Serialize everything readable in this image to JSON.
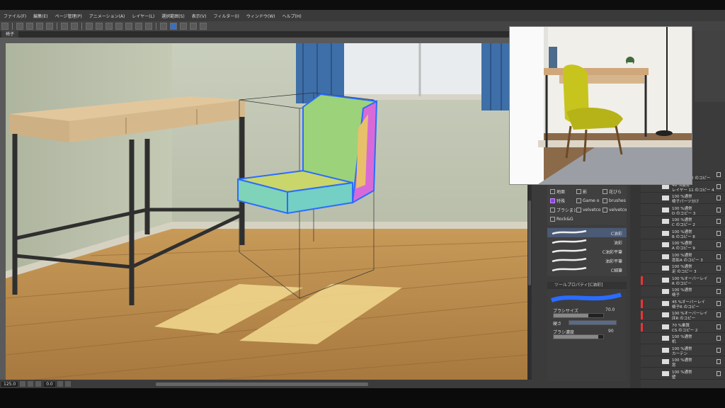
{
  "menu": [
    "ファイル(F)",
    "編集(E)",
    "ページ管理(P)",
    "アニメーション(A)",
    "レイヤー(L)",
    "選択範囲(S)",
    "表示(V)",
    "フィルター(I)",
    "ウィンドウ(W)",
    "ヘルプ(H)"
  ],
  "tab": {
    "label": "椅子"
  },
  "status": {
    "zoom": "125.0",
    "angle": "0.0"
  },
  "subtool_groups": [
    "地面",
    "影",
    "花びら",
    "特殊",
    "Game o",
    "brushes",
    "ブラシまと",
    "velvetco",
    "velvetco",
    "Rock&G"
  ],
  "brushes": [
    "C油彩",
    "油彩",
    "C油彩平筆",
    "油彩平筆",
    "C細筆"
  ],
  "tool_property": {
    "header": "ツールプロパティ[C油彩]",
    "brush_size_label": "ブラシサイズ",
    "brush_size_value": "70.0",
    "hardness_label": "硬さ",
    "density_label": "ブラシ濃度",
    "density_value": "90"
  },
  "layers": [
    {
      "l1": "100 %通常",
      "l2": "レイヤー 12 のコピー",
      "mark": ""
    },
    {
      "l1": "46 %通常",
      "l2": "レイヤー 11 のコピー 4",
      "mark": ""
    },
    {
      "l1": "100 %通常",
      "l2": "椅子パーツ分け",
      "mark": ""
    },
    {
      "l1": "100 %通常",
      "l2": "D のコピー 3",
      "mark": ""
    },
    {
      "l1": "100 %通常",
      "l2": "C のコピー 2",
      "mark": ""
    },
    {
      "l1": "100 %通常",
      "l2": "B のコピー 8",
      "mark": ""
    },
    {
      "l1": "100 %通常",
      "l2": "A のコピー 9",
      "mark": ""
    },
    {
      "l1": "100 %通常",
      "l2": "窓影A のコピー 3",
      "mark": ""
    },
    {
      "l1": "100 %通常",
      "l2": "足 のコピー 3",
      "mark": ""
    },
    {
      "l1": "100 %オーバーレイ",
      "l2": "R のコピー",
      "mark": "#e33"
    },
    {
      "l1": "100 %通常",
      "l2": "椅子",
      "mark": ""
    },
    {
      "l1": "45 %オーバーレイ",
      "l2": "椅子R のコピー",
      "mark": "#e33"
    },
    {
      "l1": "100 %オーバーレイ",
      "l2": "床R のコピー",
      "mark": "#e33"
    },
    {
      "l1": "70 %乗算",
      "l2": "CS のコピー 2",
      "mark": "#e33"
    },
    {
      "l1": "100 %通常",
      "l2": "机",
      "mark": ""
    },
    {
      "l1": "100 %通常",
      "l2": "カーテン",
      "mark": ""
    },
    {
      "l1": "100 %通常",
      "l2": "窓",
      "mark": ""
    },
    {
      "l1": "100 %通常",
      "l2": "壁",
      "mark": ""
    }
  ],
  "colors": {
    "accent": "#3a6fc2",
    "selected_group": "#8a40e0"
  }
}
